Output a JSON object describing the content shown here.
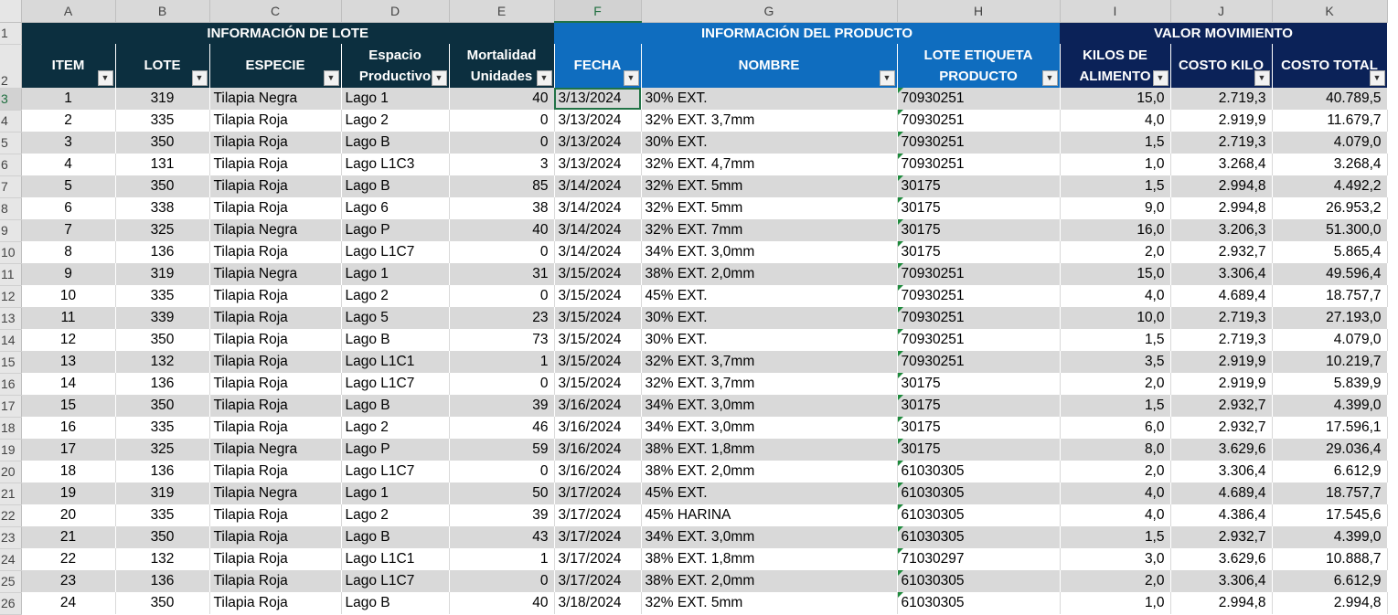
{
  "columns": [
    "A",
    "B",
    "C",
    "D",
    "E",
    "F",
    "G",
    "H",
    "I",
    "J",
    "K"
  ],
  "row_numbers": [
    "1",
    "2",
    "3",
    "4",
    "5",
    "6",
    "7",
    "8",
    "9",
    "10",
    "11",
    "12",
    "13",
    "14",
    "15",
    "16",
    "17",
    "18",
    "19",
    "20",
    "21",
    "22",
    "23",
    "24",
    "25",
    "26"
  ],
  "groups": {
    "lote": "INFORMACIÓN DE LOTE",
    "producto": "INFORMACIÓN DEL PRODUCTO",
    "valor": "VALOR MOVIMIENTO"
  },
  "headers": {
    "item": "ITEM",
    "lote": "LOTE",
    "especie": "ESPECIE",
    "espacio_1": "Espacio",
    "espacio_2": "Productivo",
    "mort_1": "Mortalidad",
    "mort_2": "Unidades",
    "fecha": "FECHA",
    "nombre": "NOMBRE",
    "lote_et_1": "LOTE ETIQUETA",
    "lote_et_2": "PRODUCTO",
    "kilos_1": "KILOS DE",
    "kilos_2": "ALIMENTO",
    "costo_kilo": "COSTO KILO",
    "costo_total": "COSTO TOTAL"
  },
  "colors": {
    "lote_header": "#0c2f3f",
    "producto_header": "#0f6dbf",
    "valor_header": "#0b2258",
    "band_row": "#d9d9d9",
    "selection": "#217346"
  },
  "rows": [
    {
      "item": "1",
      "lote": "319",
      "especie": "Tilapia Negra",
      "espacio": "Lago 1",
      "mort": "40",
      "fecha": "3/13/2024",
      "nombre": "30% EXT.",
      "lote_et": "70930251",
      "kilos": "15,0",
      "costo_kilo": "2.719,3",
      "costo_total": "40.789,5"
    },
    {
      "item": "2",
      "lote": "335",
      "especie": "Tilapia Roja",
      "espacio": "Lago 2",
      "mort": "0",
      "fecha": "3/13/2024",
      "nombre": "32% EXT. 3,7mm",
      "lote_et": "70930251",
      "kilos": "4,0",
      "costo_kilo": "2.919,9",
      "costo_total": "11.679,7"
    },
    {
      "item": "3",
      "lote": "350",
      "especie": "Tilapia Roja",
      "espacio": "Lago B",
      "mort": "0",
      "fecha": "3/13/2024",
      "nombre": "30% EXT.",
      "lote_et": "70930251",
      "kilos": "1,5",
      "costo_kilo": "2.719,3",
      "costo_total": "4.079,0"
    },
    {
      "item": "4",
      "lote": "131",
      "especie": "Tilapia Roja",
      "espacio": "Lago L1C3",
      "mort": "3",
      "fecha": "3/13/2024",
      "nombre": "32% EXT. 4,7mm",
      "lote_et": "70930251",
      "kilos": "1,0",
      "costo_kilo": "3.268,4",
      "costo_total": "3.268,4"
    },
    {
      "item": "5",
      "lote": "350",
      "especie": "Tilapia Roja",
      "espacio": "Lago B",
      "mort": "85",
      "fecha": "3/14/2024",
      "nombre": "32% EXT. 5mm",
      "lote_et": "30175",
      "kilos": "1,5",
      "costo_kilo": "2.994,8",
      "costo_total": "4.492,2"
    },
    {
      "item": "6",
      "lote": "338",
      "especie": "Tilapia Roja",
      "espacio": "Lago 6",
      "mort": "38",
      "fecha": "3/14/2024",
      "nombre": "32% EXT. 5mm",
      "lote_et": "30175",
      "kilos": "9,0",
      "costo_kilo": "2.994,8",
      "costo_total": "26.953,2"
    },
    {
      "item": "7",
      "lote": "325",
      "especie": "Tilapia Negra",
      "espacio": "Lago P",
      "mort": "40",
      "fecha": "3/14/2024",
      "nombre": "32% EXT. 7mm",
      "lote_et": "30175",
      "kilos": "16,0",
      "costo_kilo": "3.206,3",
      "costo_total": "51.300,0"
    },
    {
      "item": "8",
      "lote": "136",
      "especie": "Tilapia Roja",
      "espacio": "Lago L1C7",
      "mort": "0",
      "fecha": "3/14/2024",
      "nombre": "34% EXT. 3,0mm",
      "lote_et": "30175",
      "kilos": "2,0",
      "costo_kilo": "2.932,7",
      "costo_total": "5.865,4"
    },
    {
      "item": "9",
      "lote": "319",
      "especie": "Tilapia Negra",
      "espacio": "Lago 1",
      "mort": "31",
      "fecha": "3/15/2024",
      "nombre": "38% EXT. 2,0mm",
      "lote_et": "70930251",
      "kilos": "15,0",
      "costo_kilo": "3.306,4",
      "costo_total": "49.596,4"
    },
    {
      "item": "10",
      "lote": "335",
      "especie": "Tilapia Roja",
      "espacio": "Lago 2",
      "mort": "0",
      "fecha": "3/15/2024",
      "nombre": "45% EXT.",
      "lote_et": "70930251",
      "kilos": "4,0",
      "costo_kilo": "4.689,4",
      "costo_total": "18.757,7"
    },
    {
      "item": "11",
      "lote": "339",
      "especie": "Tilapia Roja",
      "espacio": "Lago 5",
      "mort": "23",
      "fecha": "3/15/2024",
      "nombre": "30% EXT.",
      "lote_et": "70930251",
      "kilos": "10,0",
      "costo_kilo": "2.719,3",
      "costo_total": "27.193,0"
    },
    {
      "item": "12",
      "lote": "350",
      "especie": "Tilapia Roja",
      "espacio": "Lago B",
      "mort": "73",
      "fecha": "3/15/2024",
      "nombre": "30% EXT.",
      "lote_et": "70930251",
      "kilos": "1,5",
      "costo_kilo": "2.719,3",
      "costo_total": "4.079,0"
    },
    {
      "item": "13",
      "lote": "132",
      "especie": "Tilapia Roja",
      "espacio": "Lago L1C1",
      "mort": "1",
      "fecha": "3/15/2024",
      "nombre": "32% EXT. 3,7mm",
      "lote_et": "70930251",
      "kilos": "3,5",
      "costo_kilo": "2.919,9",
      "costo_total": "10.219,7"
    },
    {
      "item": "14",
      "lote": "136",
      "especie": "Tilapia Roja",
      "espacio": "Lago L1C7",
      "mort": "0",
      "fecha": "3/15/2024",
      "nombre": "32% EXT. 3,7mm",
      "lote_et": "30175",
      "kilos": "2,0",
      "costo_kilo": "2.919,9",
      "costo_total": "5.839,9"
    },
    {
      "item": "15",
      "lote": "350",
      "especie": "Tilapia Roja",
      "espacio": "Lago B",
      "mort": "39",
      "fecha": "3/16/2024",
      "nombre": "34% EXT. 3,0mm",
      "lote_et": "30175",
      "kilos": "1,5",
      "costo_kilo": "2.932,7",
      "costo_total": "4.399,0"
    },
    {
      "item": "16",
      "lote": "335",
      "especie": "Tilapia Roja",
      "espacio": "Lago 2",
      "mort": "46",
      "fecha": "3/16/2024",
      "nombre": "34% EXT. 3,0mm",
      "lote_et": "30175",
      "kilos": "6,0",
      "costo_kilo": "2.932,7",
      "costo_total": "17.596,1"
    },
    {
      "item": "17",
      "lote": "325",
      "especie": "Tilapia Negra",
      "espacio": "Lago P",
      "mort": "59",
      "fecha": "3/16/2024",
      "nombre": "38% EXT. 1,8mm",
      "lote_et": "30175",
      "kilos": "8,0",
      "costo_kilo": "3.629,6",
      "costo_total": "29.036,4"
    },
    {
      "item": "18",
      "lote": "136",
      "especie": "Tilapia Roja",
      "espacio": "Lago L1C7",
      "mort": "0",
      "fecha": "3/16/2024",
      "nombre": "38% EXT. 2,0mm",
      "lote_et": "61030305",
      "kilos": "2,0",
      "costo_kilo": "3.306,4",
      "costo_total": "6.612,9"
    },
    {
      "item": "19",
      "lote": "319",
      "especie": "Tilapia Negra",
      "espacio": "Lago 1",
      "mort": "50",
      "fecha": "3/17/2024",
      "nombre": "45% EXT.",
      "lote_et": "61030305",
      "kilos": "4,0",
      "costo_kilo": "4.689,4",
      "costo_total": "18.757,7"
    },
    {
      "item": "20",
      "lote": "335",
      "especie": "Tilapia Roja",
      "espacio": "Lago 2",
      "mort": "39",
      "fecha": "3/17/2024",
      "nombre": "45% HARINA",
      "lote_et": "61030305",
      "kilos": "4,0",
      "costo_kilo": "4.386,4",
      "costo_total": "17.545,6"
    },
    {
      "item": "21",
      "lote": "350",
      "especie": "Tilapia Roja",
      "espacio": "Lago B",
      "mort": "43",
      "fecha": "3/17/2024",
      "nombre": "34% EXT. 3,0mm",
      "lote_et": "61030305",
      "kilos": "1,5",
      "costo_kilo": "2.932,7",
      "costo_total": "4.399,0"
    },
    {
      "item": "22",
      "lote": "132",
      "especie": "Tilapia Roja",
      "espacio": "Lago L1C1",
      "mort": "1",
      "fecha": "3/17/2024",
      "nombre": "38% EXT. 1,8mm",
      "lote_et": "71030297",
      "kilos": "3,0",
      "costo_kilo": "3.629,6",
      "costo_total": "10.888,7"
    },
    {
      "item": "23",
      "lote": "136",
      "especie": "Tilapia Roja",
      "espacio": "Lago L1C7",
      "mort": "0",
      "fecha": "3/17/2024",
      "nombre": "38% EXT. 2,0mm",
      "lote_et": "61030305",
      "kilos": "2,0",
      "costo_kilo": "3.306,4",
      "costo_total": "6.612,9"
    },
    {
      "item": "24",
      "lote": "350",
      "especie": "Tilapia Roja",
      "espacio": "Lago B",
      "mort": "40",
      "fecha": "3/18/2024",
      "nombre": "32% EXT. 5mm",
      "lote_et": "61030305",
      "kilos": "1,0",
      "costo_kilo": "2.994,8",
      "costo_total": "2.994,8"
    }
  ]
}
